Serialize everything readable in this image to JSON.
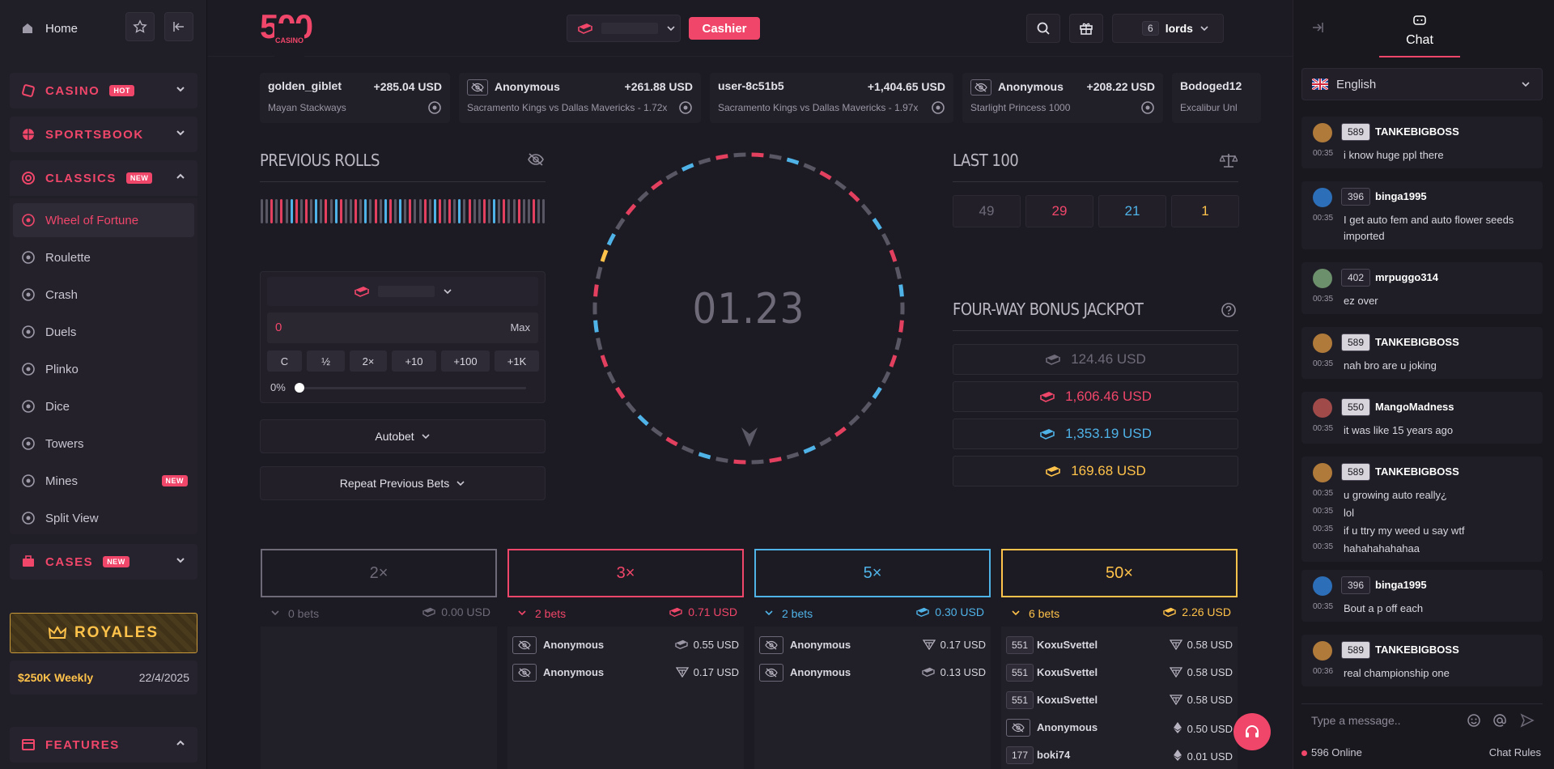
{
  "sidebar": {
    "home_label": "Home",
    "sections": [
      {
        "label": "CASINO",
        "badge": "HOT"
      },
      {
        "label": "SPORTSBOOK"
      },
      {
        "label": "CLASSICS",
        "badge": "NEW"
      },
      {
        "label": "CASES",
        "badge": "NEW"
      },
      {
        "label": "FEATURES"
      }
    ],
    "games": [
      {
        "label": "Wheel of Fortune",
        "icon": "wheel-icon",
        "active": true
      },
      {
        "label": "Roulette",
        "icon": "roulette-icon"
      },
      {
        "label": "Crash",
        "icon": "rocket-icon"
      },
      {
        "label": "Duels",
        "icon": "swords-icon"
      },
      {
        "label": "Plinko",
        "icon": "plinko-icon"
      },
      {
        "label": "Dice",
        "icon": "dice-icon"
      },
      {
        "label": "Towers",
        "icon": "diamond-icon"
      },
      {
        "label": "Mines",
        "icon": "mine-icon",
        "badge": "NEW"
      },
      {
        "label": "Split View",
        "icon": "grid-icon"
      }
    ],
    "royales": {
      "label": "ROYALES",
      "prize": "$250K Weekly",
      "date": "22/4/2025"
    }
  },
  "header": {
    "logo_main": "500",
    "logo_sub": "CASINO",
    "cashier_label": "Cashier",
    "user": {
      "level": "6",
      "name": "lords"
    }
  },
  "ticker": [
    {
      "name": "golden_giblet",
      "amount": "+285.04 USD",
      "game": "Mayan Stackways",
      "anon": false
    },
    {
      "name": "Anonymous",
      "amount": "+261.88 USD",
      "game": "Sacramento Kings vs Dallas Mavericks - 1.72x",
      "anon": true
    },
    {
      "name": "user-8c51b5",
      "amount": "+1,404.65 USD",
      "game": "Sacramento Kings vs Dallas Mavericks - 1.97x",
      "anon": false
    },
    {
      "name": "Anonymous",
      "amount": "+208.22 USD",
      "game": "Starlight Princess 1000",
      "anon": true
    },
    {
      "name": "Bodoged12",
      "amount": "",
      "game": "Excalibur Unl",
      "anon": false
    }
  ],
  "previous_rolls": {
    "title": "PREVIOUS ROLLS",
    "sequence": [
      "grey",
      "grey",
      "red",
      "grey",
      "red",
      "grey",
      "blue",
      "red",
      "grey",
      "red",
      "grey",
      "blue",
      "grey",
      "red",
      "grey",
      "blue",
      "red",
      "grey",
      "grey",
      "red",
      "grey",
      "blue",
      "grey",
      "red",
      "grey",
      "blue",
      "red",
      "grey",
      "blue",
      "grey",
      "red",
      "grey",
      "grey",
      "red",
      "grey",
      "blue",
      "red",
      "grey",
      "red",
      "grey",
      "blue",
      "grey",
      "red",
      "grey",
      "grey",
      "red",
      "grey",
      "blue",
      "grey",
      "red",
      "grey",
      "grey",
      "red",
      "grey",
      "grey",
      "red",
      "grey",
      "grey"
    ]
  },
  "bet": {
    "amount": "0",
    "max_label": "Max",
    "quick": [
      "C",
      "½",
      "2×",
      "+10",
      "+100",
      "+1K"
    ],
    "slider_label": "0%",
    "slider_value": 0,
    "autobet_label": "Autobet",
    "repeat_label": "Repeat Previous Bets"
  },
  "wheel": {
    "countdown": "01.23",
    "segments": [
      "red",
      "grey",
      "blue",
      "grey",
      "red",
      "grey",
      "red",
      "grey",
      "blue",
      "grey",
      "red",
      "grey",
      "blue",
      "grey",
      "red",
      "grey",
      "red",
      "grey",
      "blue",
      "grey",
      "grey",
      "red",
      "grey",
      "blue",
      "grey",
      "red",
      "grey",
      "red",
      "grey",
      "blue",
      "grey",
      "red",
      "grey",
      "blue",
      "grey",
      "red",
      "grey",
      "red",
      "grey",
      "blue",
      "grey",
      "red",
      "grey",
      "gold",
      "blue",
      "grey",
      "red",
      "grey",
      "red",
      "grey",
      "blue",
      "grey",
      "red",
      "grey"
    ]
  },
  "last100": {
    "title": "LAST 100",
    "counts": [
      {
        "value": "49",
        "color": "#6e6a78"
      },
      {
        "value": "29",
        "color": "#f0466a"
      },
      {
        "value": "21",
        "color": "#4fb3e8"
      },
      {
        "value": "1",
        "color": "#ffc24a"
      }
    ]
  },
  "jackpot": {
    "title": "FOUR-WAY BONUS JACKPOT",
    "values": [
      {
        "value": "124.46 USD",
        "color": "#6e6a78"
      },
      {
        "value": "1,606.46 USD",
        "color": "#f0466a"
      },
      {
        "value": "1,353.19 USD",
        "color": "#4fb3e8"
      },
      {
        "value": "169.68 USD",
        "color": "#ffc24a"
      }
    ]
  },
  "columns": [
    {
      "mult": "2×",
      "color": "#6e6a78",
      "bets": "0 bets",
      "total": "0.00 USD",
      "rows": []
    },
    {
      "mult": "3×",
      "color": "#f0466a",
      "bets": "2 bets",
      "total": "0.71 USD",
      "rows": [
        {
          "name": "Anonymous",
          "amount": "0.55 USD",
          "anon": true,
          "icon": "cash"
        },
        {
          "name": "Anonymous",
          "amount": "0.17 USD",
          "anon": true,
          "icon": "tether"
        }
      ]
    },
    {
      "mult": "5×",
      "color": "#4fb3e8",
      "bets": "2 bets",
      "total": "0.30 USD",
      "rows": [
        {
          "name": "Anonymous",
          "amount": "0.17 USD",
          "anon": true,
          "icon": "tether"
        },
        {
          "name": "Anonymous",
          "amount": "0.13 USD",
          "anon": true,
          "icon": "cash"
        }
      ]
    },
    {
      "mult": "50×",
      "color": "#ffc24a",
      "bets": "6 bets",
      "total": "2.26 USD",
      "rows": [
        {
          "name": "KoxuSvettel",
          "amount": "0.58 USD",
          "level": "551",
          "icon": "tether"
        },
        {
          "name": "KoxuSvettel",
          "amount": "0.58 USD",
          "level": "551",
          "icon": "tether"
        },
        {
          "name": "KoxuSvettel",
          "amount": "0.58 USD",
          "level": "551",
          "icon": "tether"
        },
        {
          "name": "Anonymous",
          "amount": "0.50 USD",
          "anon": true,
          "icon": "eth"
        },
        {
          "name": "boki74",
          "amount": "0.01 USD",
          "level": "177",
          "icon": "eth"
        }
      ]
    }
  ],
  "chat": {
    "tab_label": "Chat",
    "language": "English",
    "messages": [
      {
        "level": "589",
        "user": "TANKEBIGBOSS",
        "lines": [
          {
            "t": "00:35",
            "text": "i know huge ppl there"
          }
        ]
      },
      {
        "level": "396",
        "user": "binga1995",
        "lines": [
          {
            "t": "00:35",
            "text": "I get auto fem and auto flower seeds imported"
          }
        ]
      },
      {
        "level": "402",
        "user": "mrpuggo314",
        "lines": [
          {
            "t": "00:35",
            "text": "ez over"
          }
        ]
      },
      {
        "level": "589",
        "user": "TANKEBIGBOSS",
        "lines": [
          {
            "t": "00:35",
            "text": "nah bro are u joking"
          }
        ]
      },
      {
        "level": "550",
        "user": "MangoMadness",
        "lines": [
          {
            "t": "00:35",
            "text": "it was like 15 years ago"
          }
        ]
      },
      {
        "level": "589",
        "user": "TANKEBIGBOSS",
        "lines": [
          {
            "t": "00:35",
            "text": "u growing auto really¿"
          },
          {
            "t": "00:35",
            "text": "lol"
          },
          {
            "t": "00:35",
            "text": "if u ttry my weed u say wtf"
          },
          {
            "t": "00:35",
            "text": "hahahahahahaa"
          }
        ]
      },
      {
        "level": "396",
        "user": "binga1995",
        "lines": [
          {
            "t": "00:35",
            "text": "Bout a p off each"
          }
        ]
      },
      {
        "level": "589",
        "user": "TANKEBIGBOSS",
        "lines": [
          {
            "t": "00:36",
            "text": "real championship one"
          }
        ]
      }
    ],
    "input_placeholder": "Type a message..",
    "online": "596 Online",
    "rules_label": "Chat Rules"
  }
}
